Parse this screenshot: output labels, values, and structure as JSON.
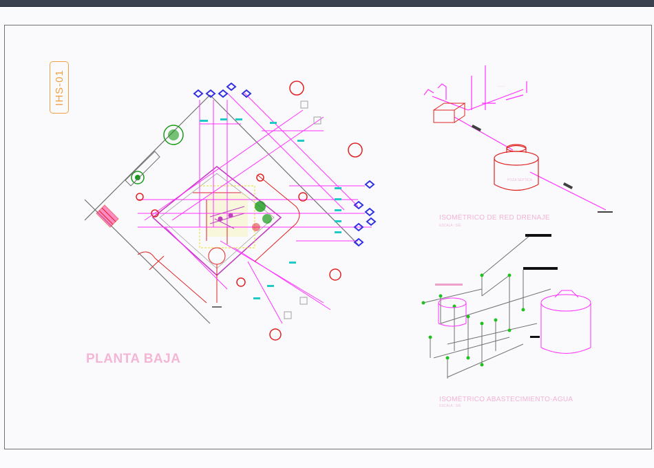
{
  "sheet": {
    "tag": "IHS-01"
  },
  "floor_plan": {
    "title": "PLANTA BAJA"
  },
  "drainage_isometric": {
    "title": "ISOMÉTRICO  DE RED DRENAJE",
    "scale": "ESCALA :  S/E",
    "tank_label": "POZA SEPTICA"
  },
  "water_isometric": {
    "title": "ISOMÉTRICO  ABASTECIMIENTO-AGUA",
    "scale": "ESCALA :  S/E"
  },
  "colors": {
    "magenta": "#ff30ff",
    "red": "#e02020",
    "green": "#1a9a1a",
    "yellow": "#e8e020",
    "cyan": "#20c8c8",
    "blue": "#3030e0",
    "title_pink": "#f4b6d6",
    "tag_orange": "#f0a040"
  }
}
